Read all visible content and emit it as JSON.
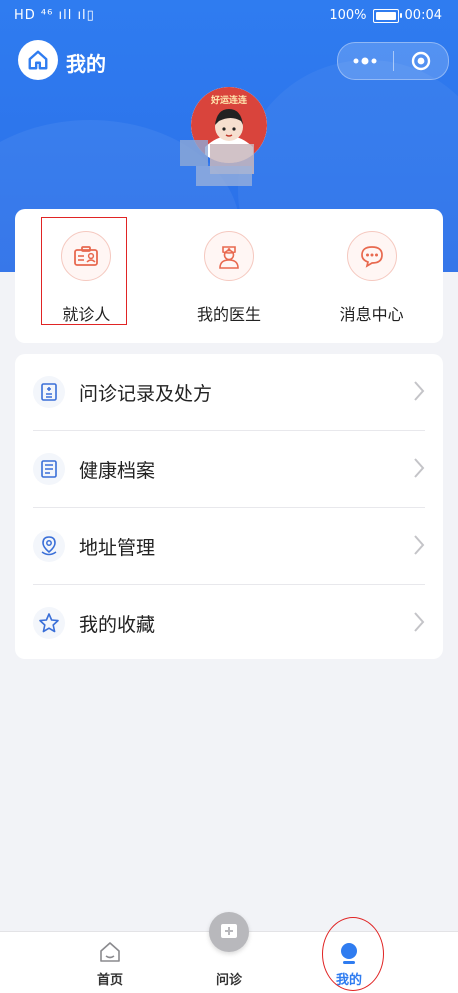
{
  "status_bar": {
    "left": "HD ⁴⁶ ıll ıl▯",
    "battery_pct": "100%",
    "time": "00:04"
  },
  "nav": {
    "title": "我的"
  },
  "quick_actions": [
    {
      "label": "就诊人",
      "icon": "patient-card-icon"
    },
    {
      "label": "我的医生",
      "icon": "doctor-icon"
    },
    {
      "label": "消息中心",
      "icon": "message-icon"
    }
  ],
  "menu": [
    {
      "label": "问诊记录及处方",
      "icon": "record-icon"
    },
    {
      "label": "健康档案",
      "icon": "health-file-icon"
    },
    {
      "label": "地址管理",
      "icon": "location-icon"
    },
    {
      "label": "我的收藏",
      "icon": "star-icon"
    }
  ],
  "tabbar": {
    "home": "首页",
    "consult": "问诊",
    "mine": "我的"
  },
  "colors": {
    "primary": "#2f7cf0",
    "accent": "#e8694f",
    "active_tab": "#2f7cf0"
  },
  "avatar": {
    "badge_text": "好运连连"
  }
}
